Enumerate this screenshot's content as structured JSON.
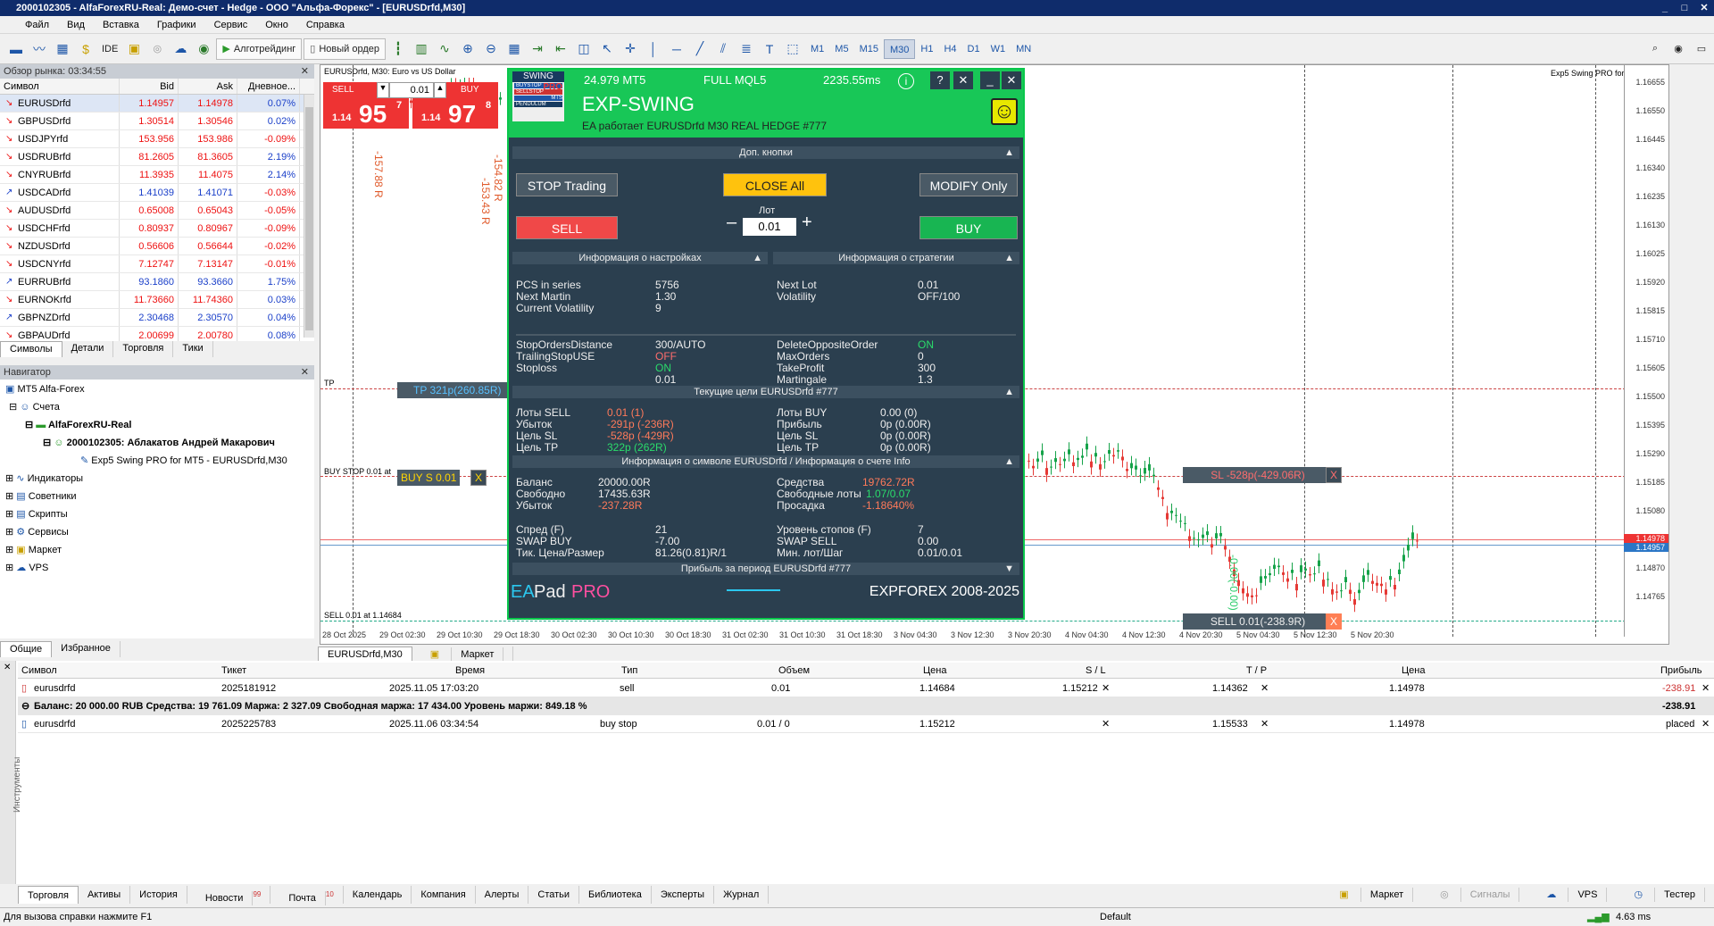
{
  "window": {
    "title": "2000102305 - AlfaForexRU-Real: Демо-счет - Hedge - ООО \"Альфа-Форекс\" - [EURUSDrfd,M30]",
    "controls": [
      "_",
      "□",
      "✕"
    ]
  },
  "menu": [
    "Файл",
    "Вид",
    "Вставка",
    "Графики",
    "Сервис",
    "Окно",
    "Справка"
  ],
  "toolbar": {
    "ide": "IDE",
    "algo": "Алготрейдинг",
    "new_order": "Новый ордер",
    "timeframes": [
      "M1",
      "M5",
      "M15",
      "M30",
      "H1",
      "H4",
      "D1",
      "W1",
      "MN"
    ],
    "active_tf": "M30"
  },
  "market_watch": {
    "title": "Обзор рынка: 03:34:55",
    "close": "✕",
    "headers": [
      "Символ",
      "Bid",
      "Ask",
      "Дневное..."
    ],
    "rows": [
      {
        "sym": "EURUSDrfd",
        "bid": "1.14957",
        "ask": "1.14978",
        "chg": "0.07%",
        "dir": "dn",
        "pos": true
      },
      {
        "sym": "GBPUSDrfd",
        "bid": "1.30514",
        "ask": "1.30546",
        "chg": "0.02%",
        "dir": "dn",
        "pos": true
      },
      {
        "sym": "USDJPYrfd",
        "bid": "153.956",
        "ask": "153.986",
        "chg": "-0.09%",
        "dir": "dn",
        "pos": false
      },
      {
        "sym": "USDRUBrfd",
        "bid": "81.2605",
        "ask": "81.3605",
        "chg": "2.19%",
        "dir": "dn",
        "pos": true
      },
      {
        "sym": "CNYRUBrfd",
        "bid": "11.3935",
        "ask": "11.4075",
        "chg": "2.14%",
        "dir": "dn",
        "pos": true
      },
      {
        "sym": "USDCADrfd",
        "bid": "1.41039",
        "ask": "1.41071",
        "chg": "-0.03%",
        "dir": "up",
        "pos": false
      },
      {
        "sym": "AUDUSDrfd",
        "bid": "0.65008",
        "ask": "0.65043",
        "chg": "-0.05%",
        "dir": "dn",
        "pos": false
      },
      {
        "sym": "USDCHFrfd",
        "bid": "0.80937",
        "ask": "0.80967",
        "chg": "-0.09%",
        "dir": "dn",
        "pos": false
      },
      {
        "sym": "NZDUSDrfd",
        "bid": "0.56606",
        "ask": "0.56644",
        "chg": "-0.02%",
        "dir": "dn",
        "pos": false
      },
      {
        "sym": "USDCNYrfd",
        "bid": "7.12747",
        "ask": "7.13147",
        "chg": "-0.01%",
        "dir": "dn",
        "pos": false
      },
      {
        "sym": "EURRUBrfd",
        "bid": "93.1860",
        "ask": "93.3660",
        "chg": "1.75%",
        "dir": "up",
        "pos": true
      },
      {
        "sym": "EURNOKrfd",
        "bid": "11.73660",
        "ask": "11.74360",
        "chg": "0.03%",
        "dir": "dn",
        "pos": true
      },
      {
        "sym": "GBPNZDrfd",
        "bid": "2.30468",
        "ask": "2.30570",
        "chg": "0.04%",
        "dir": "up",
        "pos": true
      },
      {
        "sym": "GBPAUDrfd",
        "bid": "2.00699",
        "ask": "2.00780",
        "chg": "0.08%",
        "dir": "dn",
        "pos": true
      }
    ],
    "tabs": [
      "Символы",
      "Детали",
      "Торговля",
      "Тики"
    ]
  },
  "navigator": {
    "title": "Навигатор",
    "close": "✕",
    "root": "MT5 Alfa-Forex",
    "accounts": "Счета",
    "server": "AlfaForexRU-Real",
    "account": "2000102305: Аблакатов Андрей Макарович",
    "ea": "Exp5 Swing PRO for MT5 - EURUSDrfd,M30",
    "groups": [
      "Индикаторы",
      "Советники",
      "Скрипты",
      "Сервисы",
      "Маркет",
      "VPS"
    ],
    "tabs": [
      "Общие",
      "Избранное"
    ]
  },
  "chart": {
    "symbol_title": "EURUSDrfd, M30:  Euro vs US Dollar",
    "ea_name": "Exp5 Swing PRO for MT5",
    "one_click": {
      "sell": "SELL",
      "buy": "BUY",
      "lot": "0.01",
      "sell_big": "95",
      "sell_small": "1.14",
      "sell_sup": "7",
      "buy_big": "97",
      "buy_small": "1.14",
      "buy_sup": "8"
    },
    "vertical_labels": [
      "-157.88 R",
      "-154.82 R",
      "-153.43 R"
    ],
    "tp_label": "TP",
    "tp_box": "TP 321p(260.85R)",
    "buystop_label": "BUY STOP 0.01 at",
    "buys_box": "BUY S 0.01",
    "sl_box": "SL -528p(-429.06R)",
    "sell_label": "SELL 0.01 at 1.14684",
    "sell_box": "SELL 0.01(-238.9R)",
    "box_x": "X",
    "vert_green": "-0.00(-0.00)",
    "price_axis": [
      "1.16655",
      "1.16550",
      "1.16445",
      "1.16340",
      "1.16235",
      "1.16130",
      "1.16025",
      "1.15920",
      "1.15815",
      "1.15710",
      "1.15605",
      "1.15500",
      "1.15395",
      "1.15290",
      "1.15185",
      "1.15080",
      "1.14975",
      "1.14870",
      "1.14765"
    ],
    "bid_tag": "1.14978",
    "ask_tag": "1.14957",
    "time_axis": [
      "28 Oct 2025",
      "29 Oct 02:30",
      "29 Oct 10:30",
      "29 Oct 18:30",
      "30 Oct 02:30",
      "30 Oct 10:30",
      "30 Oct 18:30",
      "31 Oct 02:30",
      "31 Oct 10:30",
      "31 Oct 18:30",
      "3 Nov 04:30",
      "3 Nov 12:30",
      "3 Nov 20:30",
      "4 Nov 04:30",
      "4 Nov 12:30",
      "4 Nov 20:30",
      "5 Nov 04:30",
      "5 Nov 12:30",
      "5 Nov 20:30"
    ],
    "tabs": [
      "EURUSDrfd,M30",
      "Маркет"
    ]
  },
  "ea": {
    "logo_top": "SWING",
    "logo_items": [
      "BUYSTOP",
      "SELLSTOP",
      "MTS",
      "PENDULUM"
    ],
    "logo_pro": "PRO",
    "version": "24.979 MT5",
    "edition": "FULL MQL5",
    "ping": "2235.55ms",
    "name": "EXP-SWING",
    "status": "EA работает EURUSDrfd M30 REAL HEDGE  #777",
    "smile": "☺",
    "sec_extra": "Доп. кнопки",
    "stop": "STOP Trading",
    "close_all": "CLOSE All",
    "modify": "MODIFY Only",
    "lot_label": "Лот",
    "lot": "0.01",
    "minus": "–",
    "plus": "+",
    "sell": "SELL",
    "buy": "BUY",
    "sec_settings": "Информация о настройках",
    "sec_strategy": "Информация о стратегии",
    "pcs_l": "PCS in series",
    "pcs_v": "5756",
    "nm_l": "Next Martin",
    "nm_v": "1.30",
    "cv_l": "Current Volatility",
    "cv_v": "9",
    "nl_l": "Next Lot",
    "nl_v": "0.01",
    "vol_l": "Volatility",
    "vol_v": "OFF/100",
    "sod_l": "StopOrdersDistance",
    "sod_v": "300/AUTO",
    "tsu_l": "TrailingStopUSE",
    "tsu_v": "OFF",
    "sl_l": "Stoploss",
    "sl_v": "ON",
    "lot2_v": "0.01",
    "doo_l": "DeleteOppositeOrder",
    "doo_v": "ON",
    "mo_l": "MaxOrders",
    "mo_v": "0",
    "tp_l": "TakeProfit",
    "tp_v": "300",
    "mart_l": "Martingale",
    "mart_v": "1.3",
    "sec_targets": "Текущие цели EURUSDrfd  #777",
    "ls_l": "Лоты SELL",
    "ls_v": "0.01 (1)",
    "ub_l": "Убыток",
    "ub_v": "-291p (-236R)",
    "csl_l": "Цель SL",
    "csl_v": "-528p (-429R)",
    "ctp_l": "Цель TP",
    "ctp_v": "322p (262R)",
    "lb_l": "Лоты BUY",
    "lb_v": "0.00 (0)",
    "pr_l": "Прибыль",
    "pr_v": "0p (0.00R)",
    "bsl_l": "Цель SL",
    "bsl_v": "0p (0.00R)",
    "btp_l": "Цель TP",
    "btp_v": "0p (0.00R)",
    "sec_info": "Информация о символе EURUSDrfd / Информация о счете Info",
    "bal_l": "Баланс",
    "bal_v": "20000.00R",
    "fr_l": "Свободно",
    "fr_v": "17435.63R",
    "loss_l": "Убыток",
    "loss_v": "-237.28R",
    "eq_l": "Средства",
    "eq_v": "19762.72R",
    "fl_l": "Свободные лоты",
    "fl_v": "1.07/0.07",
    "dd_l": "Просадка",
    "dd_v": "-1.18640%",
    "sp_l": "Спред (F)",
    "sp_v": "21",
    "swb_l": "SWAP BUY",
    "swb_v": "-7.00",
    "tick_l": "Тик. Цена/Размер",
    "tick_v": "81.26(0.81)R/1",
    "ls2_l": "Уровень стопов (F)",
    "ls2_v": "7",
    "sws_l": "SWAP SELL",
    "sws_v": "0.00",
    "ml_l": "Мин. лот/Шаг",
    "ml_v": "0.01/0.01",
    "sec_profit": "Прибыль за период EURUSDrfd  #777",
    "foot_ea": "EA",
    "foot_pad": "Pad",
    "foot_pro": "PRO",
    "foot_copy": "EXPFOREX 2008-2025"
  },
  "terminal": {
    "headers": [
      "Символ",
      "Тикет",
      "Время",
      "Тип",
      "Объем",
      "Цена",
      "S / L",
      "T / P",
      "Цена",
      "Прибыль"
    ],
    "row1": [
      "eurusdrfd",
      "2025181912",
      "2025.11.05 17:03:20",
      "sell",
      "0.01",
      "1.14684",
      "1.15212",
      "1.14362",
      "1.14978",
      "-238.91"
    ],
    "balance": "Баланс: 20 000.00 RUB  Средства: 19 761.09  Маржа: 2 327.09  Свободная маржа: 17 434.00  Уровень маржи: 849.18 %",
    "balance_profit": "-238.91",
    "row2": [
      "eurusdrfd",
      "2025225783",
      "2025.11.06 03:34:54",
      "buy stop",
      "0.01 / 0",
      "1.15212",
      "",
      "1.15533",
      "1.14978",
      "placed"
    ],
    "side": "Инструменты",
    "x": "✕",
    "tabs": [
      "Торговля",
      "Активы",
      "История",
      "Новости",
      "Почта",
      "Календарь",
      "Компания",
      "Алерты",
      "Статьи",
      "Библиотека",
      "Эксперты",
      "Журнал"
    ],
    "news_count": "99",
    "mail_count": "10",
    "right": [
      "Маркет",
      "Сигналы",
      "VPS",
      "Тестер"
    ]
  },
  "status": {
    "help": "Для вызова справки нажмите F1",
    "profile": "Default",
    "ping": "4.63 ms"
  }
}
